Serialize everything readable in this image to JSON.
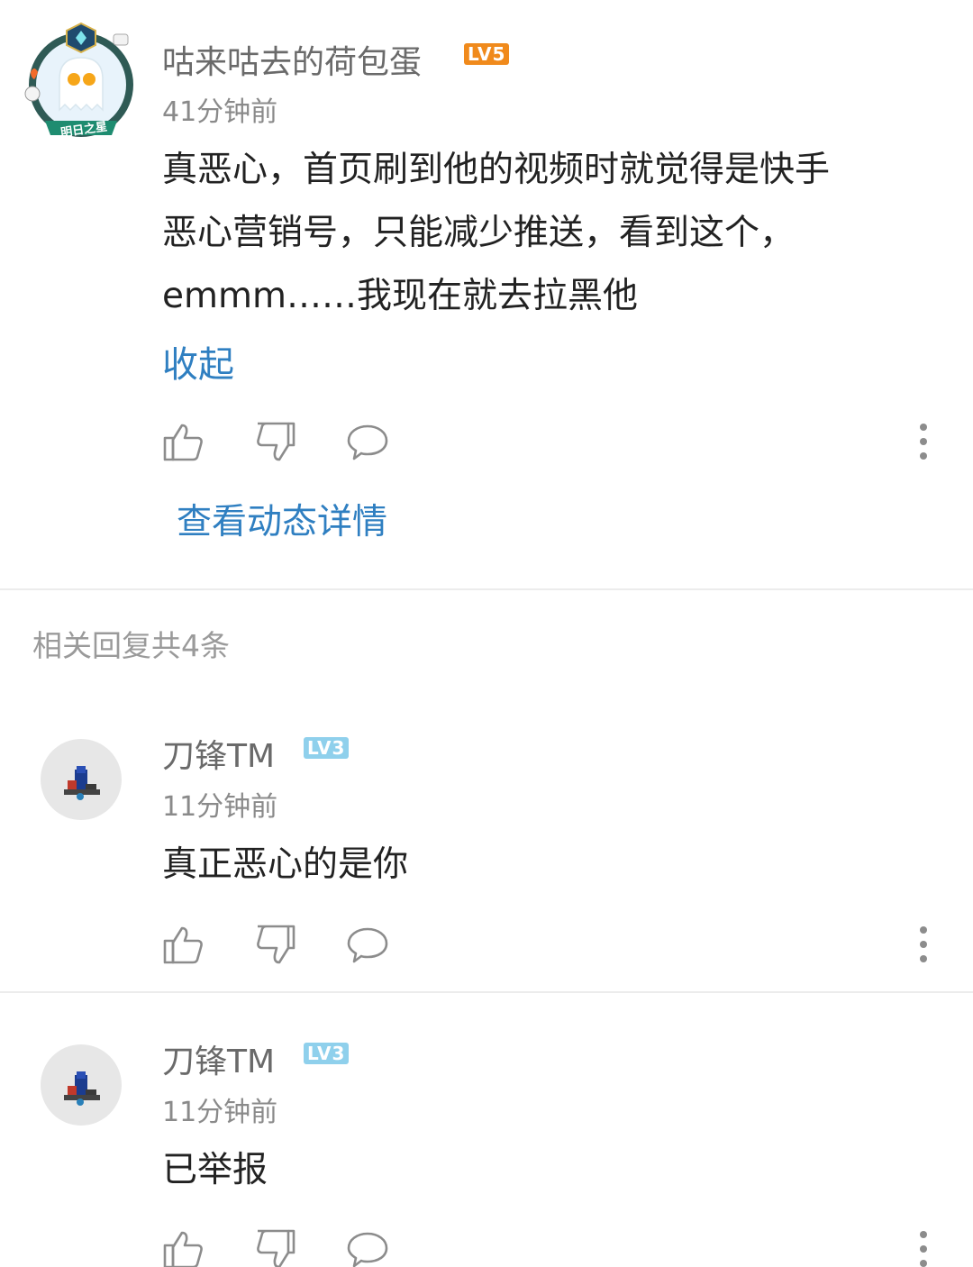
{
  "main_comment": {
    "username": "咕来咕去的荷包蛋",
    "level": "LV5",
    "time": "41分钟前",
    "text_line1": "真恶心，首页刷到他的视频时就觉得是快手",
    "text_line2": "恶心营销号，只能减少推送，看到这个，",
    "text_line3": "emmm……我现在就去拉黑他",
    "collapse_label": "收起",
    "view_detail_label": "查看动态详情",
    "avatar_badge_text": "明日之星"
  },
  "replies_header": "相关回复共4条",
  "replies": [
    {
      "username": "刀锋TM",
      "level": "LV3",
      "time": "11分钟前",
      "text": "真正恶心的是你"
    },
    {
      "username": "刀锋TM",
      "level": "LV3",
      "time": "11分钟前",
      "text": "已举报"
    }
  ],
  "icons": {
    "like": "thumbs-up-icon",
    "dislike": "thumbs-down-icon",
    "reply": "comment-bubble-icon",
    "more": "more-vertical-icon"
  },
  "colors": {
    "link": "#2f7fc1",
    "lv5": "#f08a1c",
    "lv3": "#8fd0ec",
    "username": "#6a6a6a",
    "body": "#222222"
  }
}
